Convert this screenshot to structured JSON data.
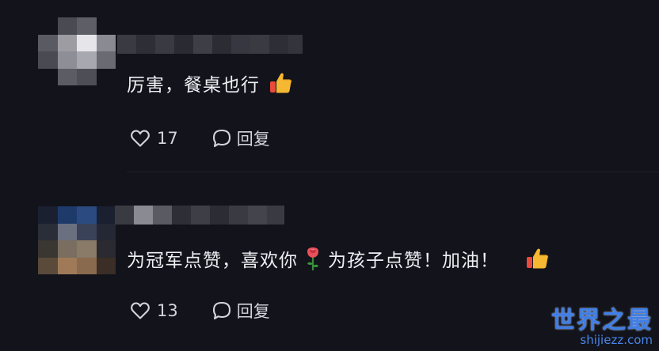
{
  "comments": [
    {
      "text": "厉害，餐桌也行",
      "emoji_end": "thumbs-up-icon",
      "likes": "17",
      "reply_label": "回复"
    },
    {
      "text_part1": "为冠军点赞，喜欢你",
      "emoji_mid": "rose-icon",
      "text_part2": "为孩子点赞！加油！",
      "emoji_end": "thumbs-up-icon",
      "likes": "13",
      "reply_label": "回复"
    }
  ],
  "watermark": {
    "title": "世界之最",
    "url": "shijiezz.com"
  },
  "colors": {
    "background": "#12131b",
    "text": "#eeeef2",
    "meta_text": "#d4d4da",
    "watermark": "#3f7ee6"
  }
}
